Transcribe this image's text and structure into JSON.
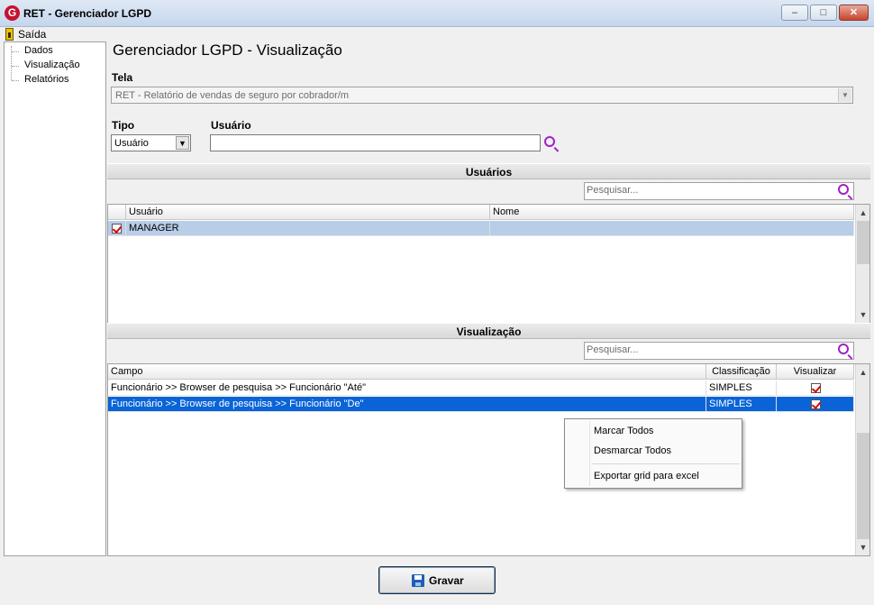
{
  "window": {
    "title": "RET - Gerenciador LGPD",
    "logo_letter": "G",
    "minimize": "–",
    "maximize": "□",
    "close": "✕"
  },
  "menu": {
    "exit_label": "Saída"
  },
  "tree": {
    "items": [
      "Dados",
      "Visualização",
      "Relatórios"
    ]
  },
  "main": {
    "title": "Gerenciador LGPD - Visualização",
    "tela_label": "Tela",
    "tela_value": "RET - Relatório de vendas de seguro por cobrador/m",
    "tipo_label": "Tipo",
    "tipo_value": "Usuário",
    "usuario_label": "Usuário",
    "usuario_value": ""
  },
  "users_section": {
    "header": "Usuários",
    "search_placeholder": "Pesquisar...",
    "columns": [
      "Usuário",
      "Nome"
    ],
    "rows": [
      {
        "checked": true,
        "usuario": "MANAGER",
        "nome": ""
      }
    ]
  },
  "view_section": {
    "header": "Visualização",
    "search_placeholder": "Pesquisar...",
    "columns": [
      "Campo",
      "Classificação",
      "Visualizar"
    ],
    "rows": [
      {
        "campo": "Funcionário >> Browser de pesquisa >> Funcionário \"Até\"",
        "classificacao": "SIMPLES",
        "visualizar": true
      },
      {
        "campo": "Funcionário >> Browser de pesquisa >> Funcionário \"De\"",
        "classificacao": "SIMPLES",
        "visualizar": true
      }
    ]
  },
  "context_menu": {
    "items": [
      "Marcar Todos",
      "Desmarcar Todos",
      "Exportar grid para excel"
    ]
  },
  "footer": {
    "save_label": "Gravar"
  },
  "colors": {
    "selection_blue": "#0a64d8",
    "accent_purple": "#a020c8"
  }
}
